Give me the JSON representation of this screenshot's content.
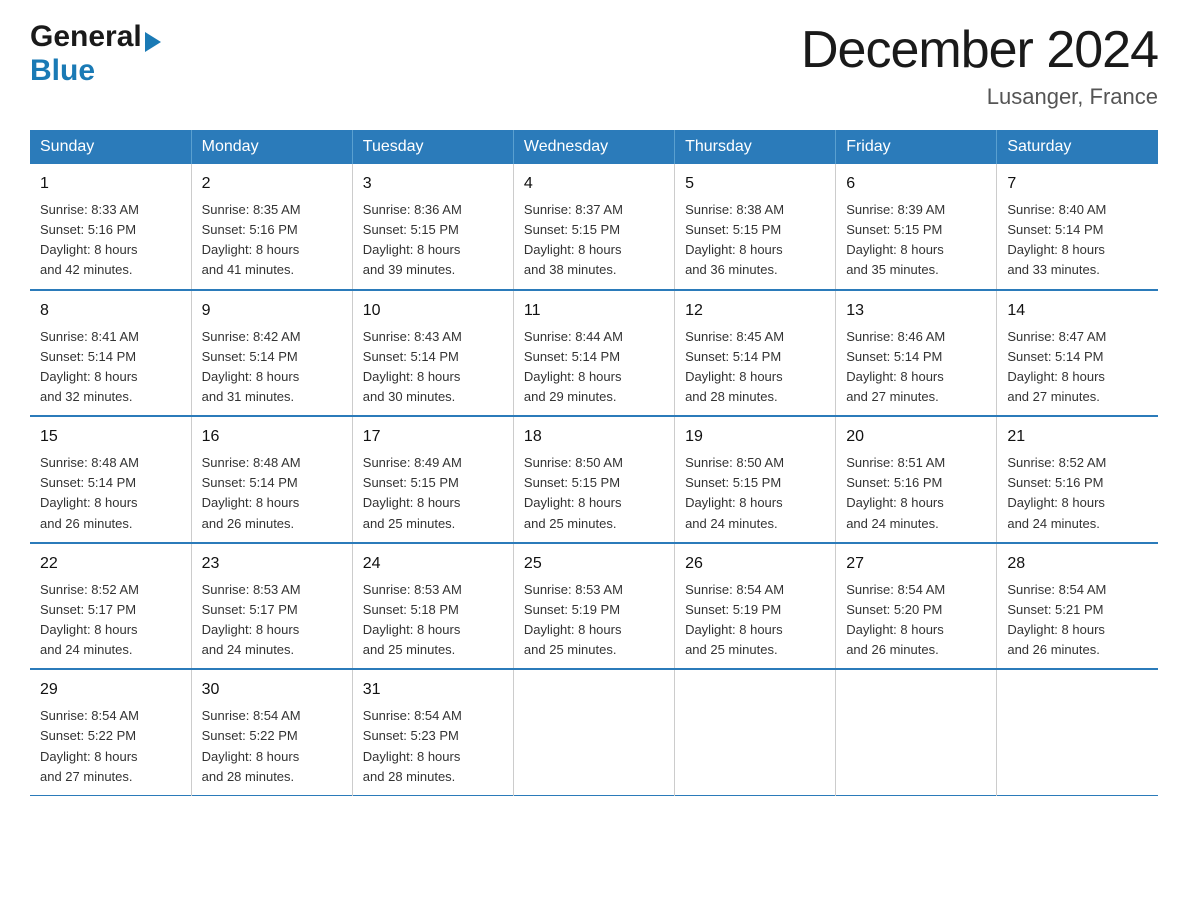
{
  "header": {
    "logo_general": "General",
    "logo_blue": "Blue",
    "month_title": "December 2024",
    "location": "Lusanger, France"
  },
  "days_of_week": [
    "Sunday",
    "Monday",
    "Tuesday",
    "Wednesday",
    "Thursday",
    "Friday",
    "Saturday"
  ],
  "weeks": [
    [
      {
        "num": "1",
        "sunrise": "8:33 AM",
        "sunset": "5:16 PM",
        "daylight": "8 hours and 42 minutes."
      },
      {
        "num": "2",
        "sunrise": "8:35 AM",
        "sunset": "5:16 PM",
        "daylight": "8 hours and 41 minutes."
      },
      {
        "num": "3",
        "sunrise": "8:36 AM",
        "sunset": "5:15 PM",
        "daylight": "8 hours and 39 minutes."
      },
      {
        "num": "4",
        "sunrise": "8:37 AM",
        "sunset": "5:15 PM",
        "daylight": "8 hours and 38 minutes."
      },
      {
        "num": "5",
        "sunrise": "8:38 AM",
        "sunset": "5:15 PM",
        "daylight": "8 hours and 36 minutes."
      },
      {
        "num": "6",
        "sunrise": "8:39 AM",
        "sunset": "5:15 PM",
        "daylight": "8 hours and 35 minutes."
      },
      {
        "num": "7",
        "sunrise": "8:40 AM",
        "sunset": "5:14 PM",
        "daylight": "8 hours and 33 minutes."
      }
    ],
    [
      {
        "num": "8",
        "sunrise": "8:41 AM",
        "sunset": "5:14 PM",
        "daylight": "8 hours and 32 minutes."
      },
      {
        "num": "9",
        "sunrise": "8:42 AM",
        "sunset": "5:14 PM",
        "daylight": "8 hours and 31 minutes."
      },
      {
        "num": "10",
        "sunrise": "8:43 AM",
        "sunset": "5:14 PM",
        "daylight": "8 hours and 30 minutes."
      },
      {
        "num": "11",
        "sunrise": "8:44 AM",
        "sunset": "5:14 PM",
        "daylight": "8 hours and 29 minutes."
      },
      {
        "num": "12",
        "sunrise": "8:45 AM",
        "sunset": "5:14 PM",
        "daylight": "8 hours and 28 minutes."
      },
      {
        "num": "13",
        "sunrise": "8:46 AM",
        "sunset": "5:14 PM",
        "daylight": "8 hours and 27 minutes."
      },
      {
        "num": "14",
        "sunrise": "8:47 AM",
        "sunset": "5:14 PM",
        "daylight": "8 hours and 27 minutes."
      }
    ],
    [
      {
        "num": "15",
        "sunrise": "8:48 AM",
        "sunset": "5:14 PM",
        "daylight": "8 hours and 26 minutes."
      },
      {
        "num": "16",
        "sunrise": "8:48 AM",
        "sunset": "5:14 PM",
        "daylight": "8 hours and 26 minutes."
      },
      {
        "num": "17",
        "sunrise": "8:49 AM",
        "sunset": "5:15 PM",
        "daylight": "8 hours and 25 minutes."
      },
      {
        "num": "18",
        "sunrise": "8:50 AM",
        "sunset": "5:15 PM",
        "daylight": "8 hours and 25 minutes."
      },
      {
        "num": "19",
        "sunrise": "8:50 AM",
        "sunset": "5:15 PM",
        "daylight": "8 hours and 24 minutes."
      },
      {
        "num": "20",
        "sunrise": "8:51 AM",
        "sunset": "5:16 PM",
        "daylight": "8 hours and 24 minutes."
      },
      {
        "num": "21",
        "sunrise": "8:52 AM",
        "sunset": "5:16 PM",
        "daylight": "8 hours and 24 minutes."
      }
    ],
    [
      {
        "num": "22",
        "sunrise": "8:52 AM",
        "sunset": "5:17 PM",
        "daylight": "8 hours and 24 minutes."
      },
      {
        "num": "23",
        "sunrise": "8:53 AM",
        "sunset": "5:17 PM",
        "daylight": "8 hours and 24 minutes."
      },
      {
        "num": "24",
        "sunrise": "8:53 AM",
        "sunset": "5:18 PM",
        "daylight": "8 hours and 25 minutes."
      },
      {
        "num": "25",
        "sunrise": "8:53 AM",
        "sunset": "5:19 PM",
        "daylight": "8 hours and 25 minutes."
      },
      {
        "num": "26",
        "sunrise": "8:54 AM",
        "sunset": "5:19 PM",
        "daylight": "8 hours and 25 minutes."
      },
      {
        "num": "27",
        "sunrise": "8:54 AM",
        "sunset": "5:20 PM",
        "daylight": "8 hours and 26 minutes."
      },
      {
        "num": "28",
        "sunrise": "8:54 AM",
        "sunset": "5:21 PM",
        "daylight": "8 hours and 26 minutes."
      }
    ],
    [
      {
        "num": "29",
        "sunrise": "8:54 AM",
        "sunset": "5:22 PM",
        "daylight": "8 hours and 27 minutes."
      },
      {
        "num": "30",
        "sunrise": "8:54 AM",
        "sunset": "5:22 PM",
        "daylight": "8 hours and 28 minutes."
      },
      {
        "num": "31",
        "sunrise": "8:54 AM",
        "sunset": "5:23 PM",
        "daylight": "8 hours and 28 minutes."
      },
      null,
      null,
      null,
      null
    ]
  ],
  "labels": {
    "sunrise": "Sunrise:",
    "sunset": "Sunset:",
    "daylight": "Daylight:"
  }
}
